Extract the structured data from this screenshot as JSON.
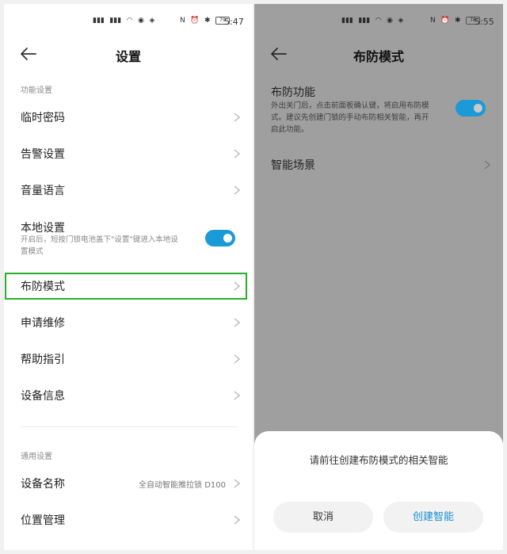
{
  "left": {
    "status": {
      "left_icons": [
        "HD",
        "4G",
        "5G",
        "wifi",
        "msg",
        "app",
        "app"
      ],
      "right_icons": [
        "NFC",
        "alarm",
        "bluetooth"
      ],
      "battery": "79",
      "time": "5:47"
    },
    "header": {
      "title": "设置"
    },
    "section1": "功能设置",
    "items": [
      {
        "label": "临时密码"
      },
      {
        "label": "告警设置"
      },
      {
        "label": "音量语言"
      }
    ],
    "local": {
      "label": "本地设置",
      "desc": "开启后，短按门锁电池盖下\"设置\"键进入本地设置模式",
      "toggle": "on"
    },
    "items2": [
      {
        "label": "布防模式"
      },
      {
        "label": "申请维修"
      },
      {
        "label": "帮助指引"
      },
      {
        "label": "设备信息"
      }
    ],
    "section2": "通用设置",
    "device_name": {
      "label": "设备名称",
      "value": "全自动智能推拉锁 D100"
    },
    "location": {
      "label": "位置管理"
    },
    "accent": "#1a9bd7",
    "highlight_color": "#2aae2a"
  },
  "right": {
    "status": {
      "battery": "78",
      "time": "5:55"
    },
    "header": {
      "title": "布防模式"
    },
    "arm": {
      "title": "布防功能",
      "desc": "外出关门后，点击前面板确认键，将启用布防模式。建议先创建门锁的手动布防相关智能，再开启此功能。",
      "toggle": "on"
    },
    "scene": {
      "label": "智能场景"
    },
    "dialog": {
      "message": "请前往创建布防模式的相关智能",
      "cancel": "取消",
      "confirm": "创建智能"
    },
    "overlay_color": "#9f9f9f"
  }
}
